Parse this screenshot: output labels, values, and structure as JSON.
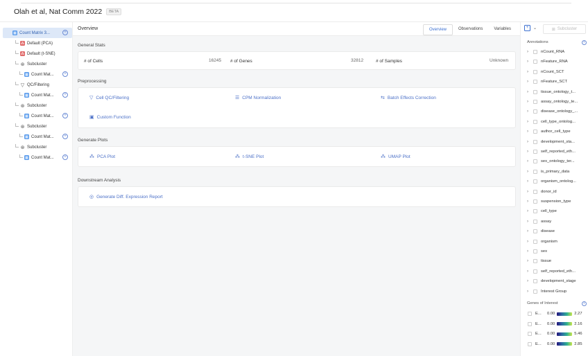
{
  "header": {
    "title": "Olah et al, Nat Comm 2022",
    "badge": "BETA"
  },
  "tree": [
    {
      "label": "Count Matrix 3...",
      "icon": "grid-icon",
      "level": 0,
      "add": true,
      "selected": true
    },
    {
      "label": "Default (PCA)",
      "icon": "plot-icon",
      "level": 1,
      "add": false
    },
    {
      "label": "Default (t-SNE)",
      "icon": "plot-icon",
      "level": 1,
      "add": false
    },
    {
      "label": "Subcluster",
      "icon": "subcluster-icon",
      "level": 1,
      "add": false
    },
    {
      "label": "Count Mat...",
      "icon": "grid-icon",
      "level": 2,
      "add": true
    },
    {
      "label": "QC/Filtering",
      "icon": "filter-icon",
      "level": 1,
      "add": false
    },
    {
      "label": "Count Mat...",
      "icon": "grid-icon",
      "level": 2,
      "add": true
    },
    {
      "label": "Subcluster",
      "icon": "subcluster-icon",
      "level": 1,
      "add": false
    },
    {
      "label": "Count Mat...",
      "icon": "grid-icon",
      "level": 2,
      "add": true
    },
    {
      "label": "Subcluster",
      "icon": "subcluster-icon",
      "level": 1,
      "add": false
    },
    {
      "label": "Count Mat...",
      "icon": "grid-icon",
      "level": 2,
      "add": true
    },
    {
      "label": "Subcluster",
      "icon": "subcluster-icon",
      "level": 1,
      "add": false
    },
    {
      "label": "Count Mat...",
      "icon": "grid-icon",
      "level": 2,
      "add": true
    }
  ],
  "overview": {
    "title": "Overview",
    "tabs": [
      "Overview",
      "Observations",
      "Variables"
    ],
    "active_tab": "Overview"
  },
  "general": {
    "title": "General Stats",
    "cells_label": "# of Cells",
    "cells_value": "16245",
    "genes_label": "# of Genes",
    "genes_value": "32812",
    "samples_label": "# of Samples",
    "samples_value": "Unknown"
  },
  "preprocessing": {
    "title": "Preprocessing",
    "qc": "Cell QC/Filtering",
    "cpm": "CPM Normalization",
    "batch": "Batch Effects Correction",
    "custom": "Custom Function"
  },
  "plots": {
    "title": "Generate Plots",
    "pca": "PCA Plot",
    "tsne": "t-SNE Plot",
    "umap": "UMAP Plot"
  },
  "downstream": {
    "title": "Downstream Analysis",
    "diff": "Generate Diff. Expression Report"
  },
  "right": {
    "subcluster_button": "Subcluster",
    "annotations_title": "Annotations",
    "genes_title": "Genes of Interest"
  },
  "annotations": [
    "nCount_RNA",
    "nFeature_RNA",
    "nCount_SCT",
    "nFeature_SCT",
    "tissue_ontology_t...",
    "assay_ontology_te...",
    "disease_ontology_...",
    "cell_type_ontolog...",
    "author_cell_type",
    "development_sta...",
    "self_reported_eth...",
    "sex_ontology_ter...",
    "is_primary_data",
    "organism_ontolog...",
    "donor_id",
    "suspension_type",
    "cell_type",
    "assay",
    "disease",
    "organism",
    "sex",
    "tissue",
    "self_reported_eth...",
    "development_stage",
    "Interest Group"
  ],
  "genes": [
    {
      "name": "E...",
      "min": "0.00",
      "max": "2.27"
    },
    {
      "name": "E...",
      "min": "0.00",
      "max": "2.16"
    },
    {
      "name": "E...",
      "min": "0.00",
      "max": "5.46"
    },
    {
      "name": "E...",
      "min": "0.00",
      "max": "2.85"
    }
  ]
}
